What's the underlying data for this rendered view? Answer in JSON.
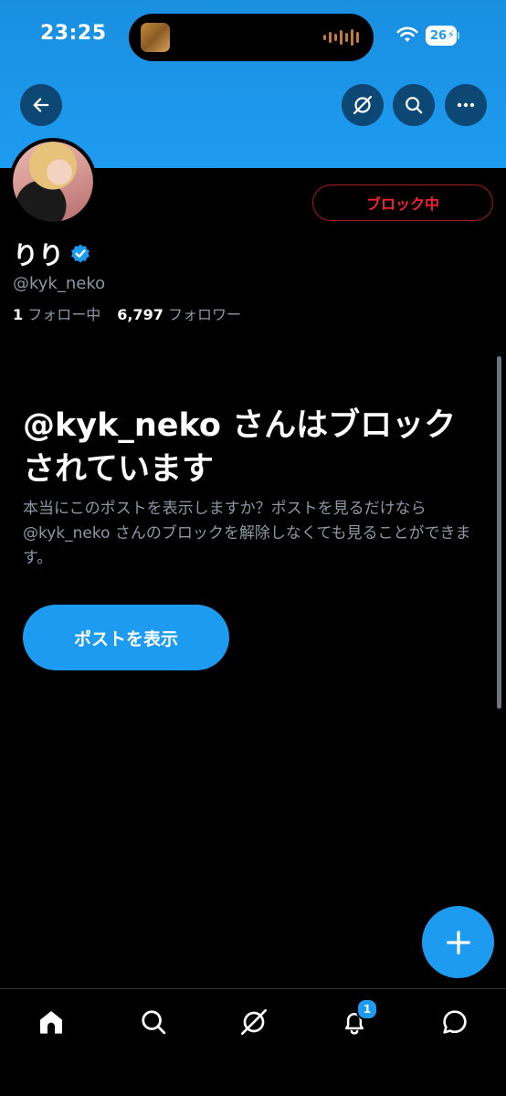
{
  "status_bar": {
    "time": "23:25",
    "battery": "26"
  },
  "profile": {
    "display_name": "りり",
    "handle": "@kyk_neko",
    "following_count": "1",
    "following_label": "フォロー中",
    "followers_count": "6,797",
    "followers_label": "フォロワー",
    "blocking_button_label": "ブロック中",
    "verified_color": "#1d9bf0"
  },
  "blocked_notice": {
    "title": "@kyk_neko さんはブロックされています",
    "description": "本当にこのポストを表示しますか？ポストを見るだけなら @kyk_neko さんのブロックを解除しなくても見ることができます。",
    "show_posts_label": "ポストを表示"
  },
  "tab_bar": {
    "notification_badge": "1"
  },
  "colors": {
    "accent": "#1d9bf0",
    "danger": "#f4212e",
    "background": "#000000",
    "secondary_text": "#8b98a5"
  },
  "icons": {
    "back": "arrow-left-icon",
    "grok": "grok-icon",
    "search": "search-icon",
    "more": "more-horizontal-icon",
    "verified": "verified-badge-icon",
    "compose": "plus-icon",
    "tabs": [
      "home-icon",
      "search-icon",
      "grok-icon",
      "bell-icon",
      "messages-icon"
    ]
  }
}
